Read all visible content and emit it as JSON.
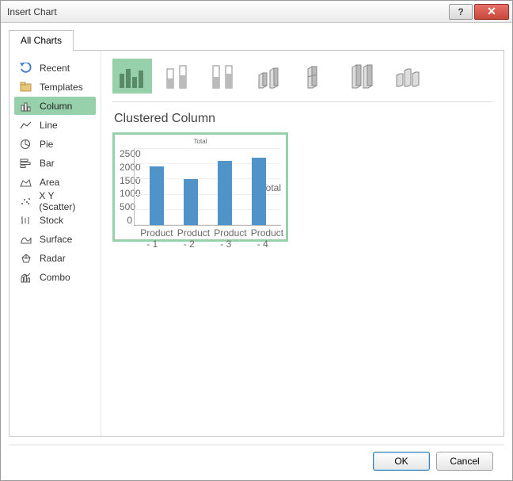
{
  "window": {
    "title": "Insert Chart"
  },
  "tabs": [
    {
      "label": "All Charts"
    }
  ],
  "sidebar": {
    "items": [
      {
        "label": "Recent"
      },
      {
        "label": "Templates"
      },
      {
        "label": "Column"
      },
      {
        "label": "Line"
      },
      {
        "label": "Pie"
      },
      {
        "label": "Bar"
      },
      {
        "label": "Area"
      },
      {
        "label": "X Y (Scatter)"
      },
      {
        "label": "Stock"
      },
      {
        "label": "Surface"
      },
      {
        "label": "Radar"
      },
      {
        "label": "Combo"
      }
    ],
    "selected_index": 2
  },
  "subtypes": {
    "selected_index": 0,
    "title": "Clustered Column"
  },
  "buttons": {
    "ok": "OK",
    "cancel": "Cancel"
  },
  "colors": {
    "accent": "#97d1ab",
    "bar": "#4f93c9"
  },
  "chart_data": {
    "type": "bar",
    "title": "Total",
    "categories": [
      "Product - 1",
      "Product - 2",
      "Product - 3",
      "Product - 4"
    ],
    "values": [
      1900,
      1500,
      2100,
      2200
    ],
    "legend": "Total",
    "ylim": [
      0,
      2500
    ],
    "yticks": [
      0,
      500,
      1000,
      1500,
      2000,
      2500
    ]
  }
}
